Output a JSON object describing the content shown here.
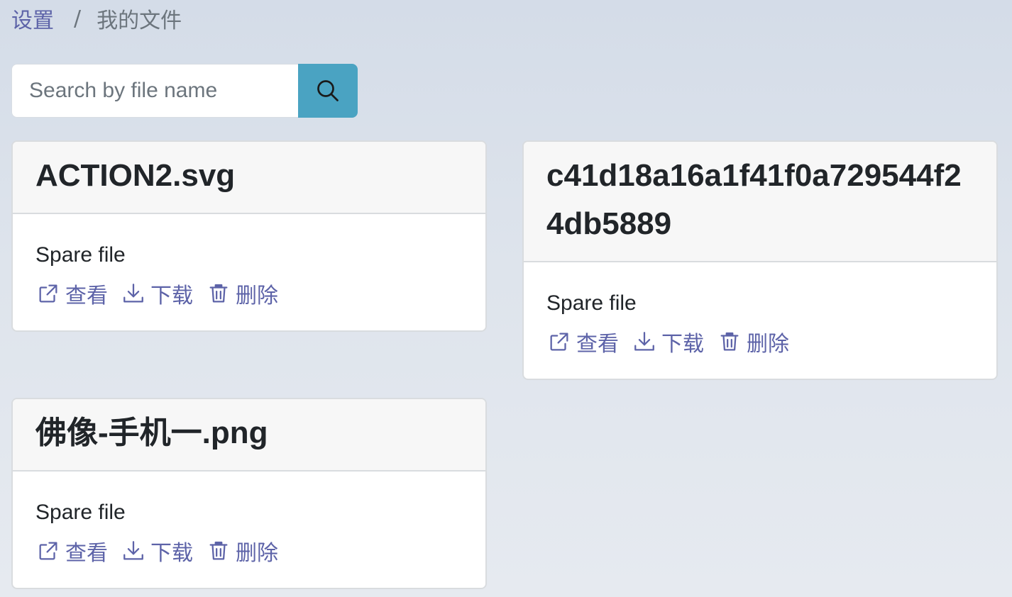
{
  "breadcrumb": {
    "parent": "设置",
    "separator": "/",
    "current": "我的文件"
  },
  "search": {
    "placeholder": "Search by file name",
    "value": "",
    "button_icon": "search-icon"
  },
  "files": [
    {
      "name": "ACTION2.svg",
      "type_label": "Spare file",
      "actions": {
        "view": "查看",
        "download": "下载",
        "delete": "删除"
      }
    },
    {
      "name": "c41d18a16a1f41f0a729544f24db5889",
      "type_label": "Spare file",
      "actions": {
        "view": "查看",
        "download": "下载",
        "delete": "删除"
      }
    },
    {
      "name": "佛像-手机一.png",
      "type_label": "Spare file",
      "actions": {
        "view": "查看",
        "download": "下载",
        "delete": "删除"
      }
    }
  ],
  "icons": {
    "view": "external-link-icon",
    "download": "download-icon",
    "delete": "trash-icon"
  },
  "colors": {
    "link": "#5d63a8",
    "search_button": "#4aa3c2",
    "card_header": "#f7f7f7"
  }
}
